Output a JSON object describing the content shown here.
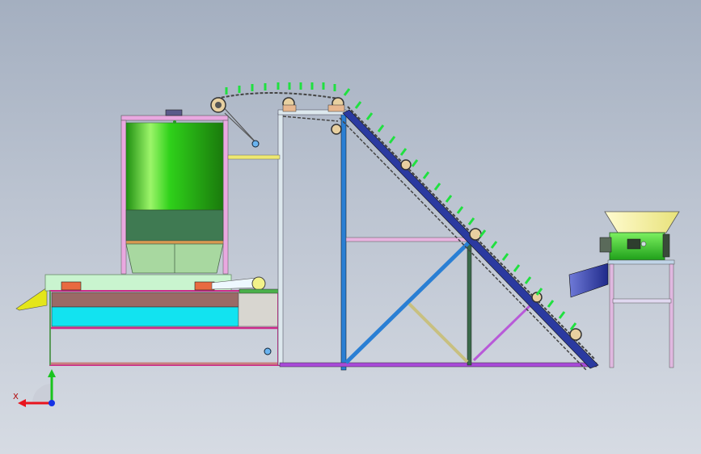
{
  "triad": {
    "x_label": "X",
    "x_color": "#e8141e",
    "y_color": "#19c41e",
    "z_color": "#1432e6"
  },
  "colors": {
    "background_top": "#a4afc0",
    "background_bottom": "#d6dbe3",
    "tank_body": "#2fd11a",
    "tank_bottom": "#3f7a52",
    "hopper_yellow": "#f2ee9c",
    "chute_blue": "#2b3aa0",
    "cyan_tray": "#12e3f0",
    "frame_magenta": "#cc2a8a",
    "frame_blue": "#2a7fd4",
    "cleats_green": "#20e040"
  },
  "icons": [
    "coordinate-triad-icon"
  ]
}
